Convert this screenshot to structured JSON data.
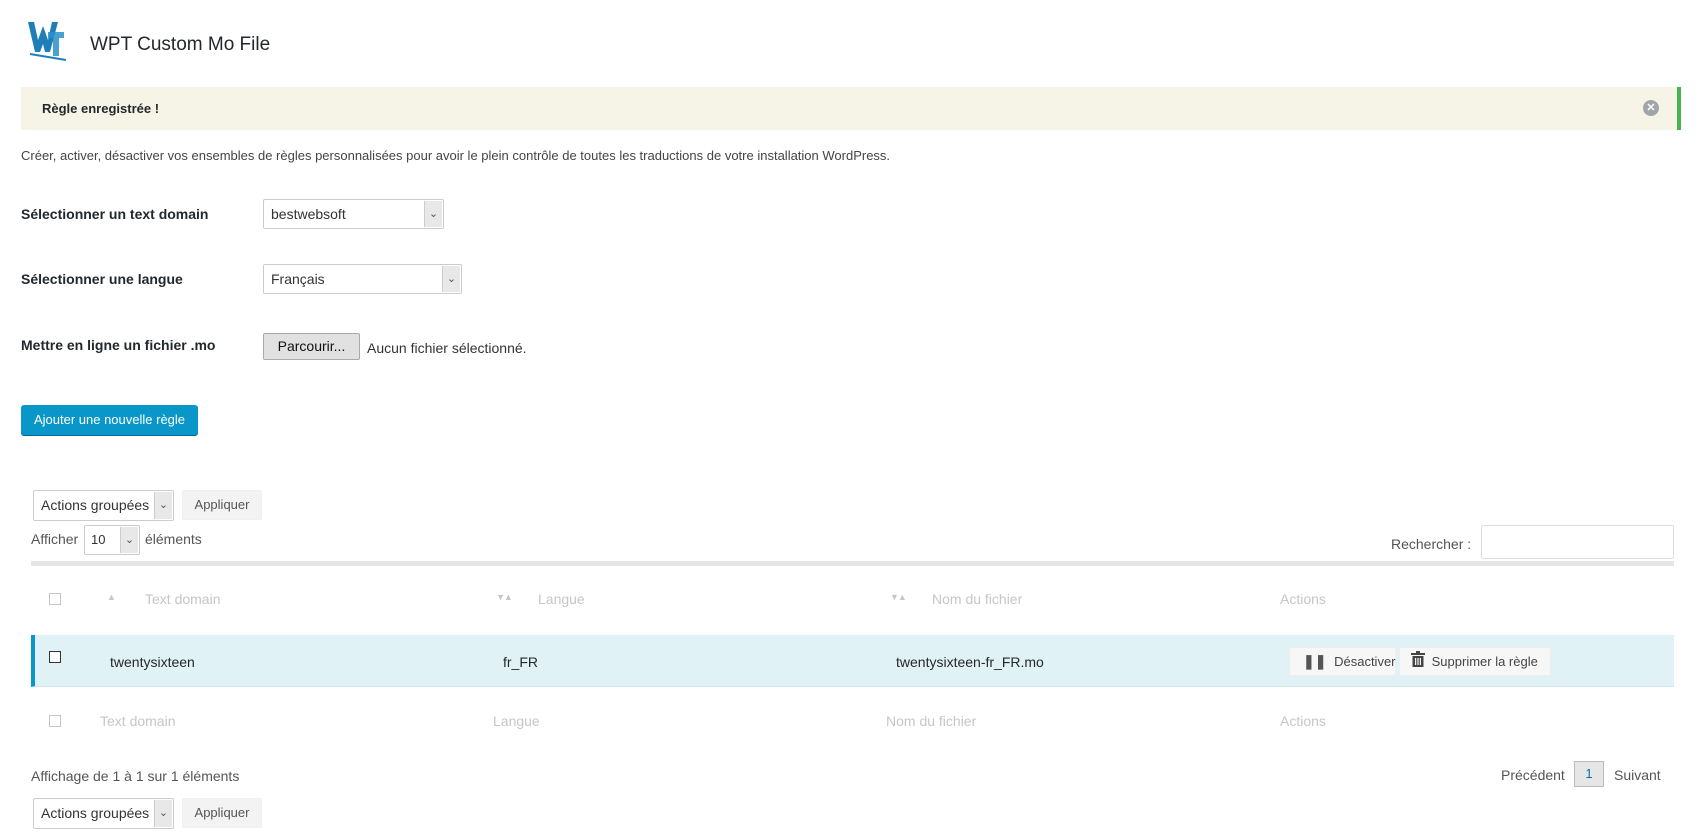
{
  "header": {
    "title": "WPT Custom Mo File",
    "logo_text": "WPT"
  },
  "notice": {
    "message": "Règle enregistrée !",
    "close_icon": "close-circle-icon"
  },
  "description": "Créer, activer, désactiver vos ensembles de règles personnalisées pour avoir le plein contrôle de toutes les traductions de votre installation WordPress.",
  "form": {
    "text_domain_label": "Sélectionner un text domain",
    "text_domain_value": "bestwebsoft",
    "language_label": "Sélectionner une langue",
    "language_value": "Français",
    "upload_label": "Mettre en ligne un fichier .mo",
    "browse_label": "Parcourir...",
    "file_status": "Aucun fichier sélectionné.",
    "add_rule_label": "Ajouter une nouvelle règle"
  },
  "bulk_top": {
    "select_value": "Actions groupées",
    "apply_label": "Appliquer"
  },
  "length": {
    "prefix": "Afficher",
    "value": "10",
    "suffix": "éléments"
  },
  "search": {
    "label": "Rechercher :",
    "value": ""
  },
  "table": {
    "headers": [
      "Text domain",
      "Langue",
      "Nom du fichier",
      "Actions"
    ],
    "rows": [
      {
        "text_domain": "twentysixteen",
        "langue": "fr_FR",
        "fichier": "twentysixteen-fr_FR.mo",
        "deactivate_label": "Désactiver",
        "delete_label": "Supprimer la règle"
      }
    ],
    "footers": [
      "Text domain",
      "Langue",
      "Nom du fichier",
      "Actions"
    ]
  },
  "info": "Affichage de 1 à 1 sur 1 éléments",
  "pagination": {
    "previous": "Précédent",
    "current": "1",
    "next": "Suivant"
  },
  "bulk_bottom": {
    "select_value": "Actions groupées",
    "apply_label": "Appliquer"
  },
  "colors": {
    "accent": "#0897c8",
    "notice_border": "#46b450",
    "notice_bg": "#f6f4e6",
    "row_highlight": "#e1f2f6"
  }
}
